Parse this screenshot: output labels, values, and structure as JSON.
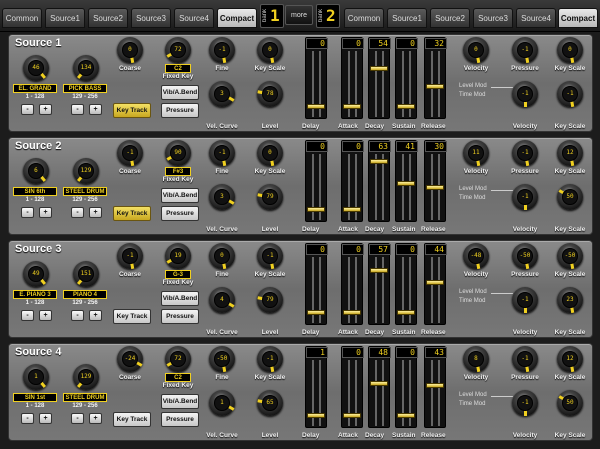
{
  "tabs_left": [
    "Common",
    "Source1",
    "Source2",
    "Source3",
    "Source4",
    "Compact"
  ],
  "tabs_right": [
    "Common",
    "Source1",
    "Source2",
    "Source3",
    "Source4",
    "Compact"
  ],
  "active_tab": "Compact",
  "bank_label": "bank",
  "bank_left": "1",
  "bank_right": "2",
  "more_label": "more",
  "labels": {
    "coarse": "Coarse",
    "fixed_key": "Fixed Key",
    "fine": "Fine",
    "key_scale": "Key Scale",
    "vel_curve": "Vel. Curve",
    "level": "Level",
    "delay": "Delay",
    "attack": "Attack",
    "decay": "Decay",
    "sustain": "Sustain",
    "release": "Release",
    "velocity": "Velocity",
    "pressure": "Pressure",
    "level_mod": "Level Mod",
    "time_mod": "Time Mod",
    "key_track": "Key Track",
    "vib": "Vib/A.Bend",
    "pressure_btn": "Pressure",
    "minus": "-",
    "plus": "+",
    "range1": "1 - 128",
    "range2": "129 - 256"
  },
  "sources": [
    {
      "title": "Source 1",
      "w1": "46",
      "w2": "134",
      "wave1": "EL. GRAND",
      "wave2": "PICK BASS",
      "coarse": "0",
      "fixed": "72",
      "fixed_key": "C2",
      "fine": "-1",
      "key_scale": "0",
      "vel_curve": "3",
      "level": "78",
      "key_track_on": true,
      "delay": "0",
      "attack": "0",
      "decay": "54",
      "sustain": "0",
      "release": "32",
      "lm_vel": "0",
      "lm_press": "-1",
      "lm_ks": "0",
      "tm_vel": "-1",
      "tm_press": "-1",
      "tm_ks": "-1"
    },
    {
      "title": "Source 2",
      "w1": "6",
      "w2": "129",
      "wave1": "SIN 6th",
      "wave2": "STEEL DRUM",
      "coarse": "-1",
      "fixed": "90",
      "fixed_key": "F#3",
      "fine": "-1",
      "key_scale": "0",
      "vel_curve": "3",
      "level": "79",
      "key_track_on": true,
      "delay": "0",
      "attack": "0",
      "decay": "63",
      "sustain": "41",
      "release": "30",
      "lm_vel": "11",
      "lm_press": "-1",
      "lm_ks": "12",
      "tm_vel": "-1",
      "tm_press": "-1",
      "tm_ks": "50"
    },
    {
      "title": "Source 3",
      "w1": "49",
      "w2": "151",
      "wave1": "E. PIANO 3",
      "wave2": "PIANO 4",
      "coarse": "-1",
      "fixed": "19",
      "fixed_key": "G-3",
      "fine": "0",
      "key_scale": "-1",
      "vel_curve": "4",
      "level": "79",
      "key_track_on": false,
      "delay": "0",
      "attack": "0",
      "decay": "57",
      "sustain": "0",
      "release": "44",
      "lm_vel": "-48",
      "lm_press": "-50",
      "lm_ks": "-50",
      "tm_vel": "-1",
      "tm_press": "0",
      "tm_ks": "23"
    },
    {
      "title": "Source 4",
      "w1": "1",
      "w2": "129",
      "wave1": "SIN 1st",
      "wave2": "STEEL DRUM",
      "coarse": "-24",
      "fixed": "72",
      "fixed_key": "C2",
      "fine": "-50",
      "key_scale": "-1",
      "vel_curve": "1",
      "level": "65",
      "key_track_on": false,
      "delay": "1",
      "attack": "0",
      "decay": "48",
      "sustain": "0",
      "release": "43",
      "lm_vel": "8",
      "lm_press": "-1",
      "lm_ks": "12",
      "tm_vel": "-1",
      "tm_press": "0",
      "tm_ks": "50"
    }
  ],
  "colors": {
    "accent": "#f0d020",
    "panel": "#7a7a7a",
    "background": "#1c1c1c"
  }
}
